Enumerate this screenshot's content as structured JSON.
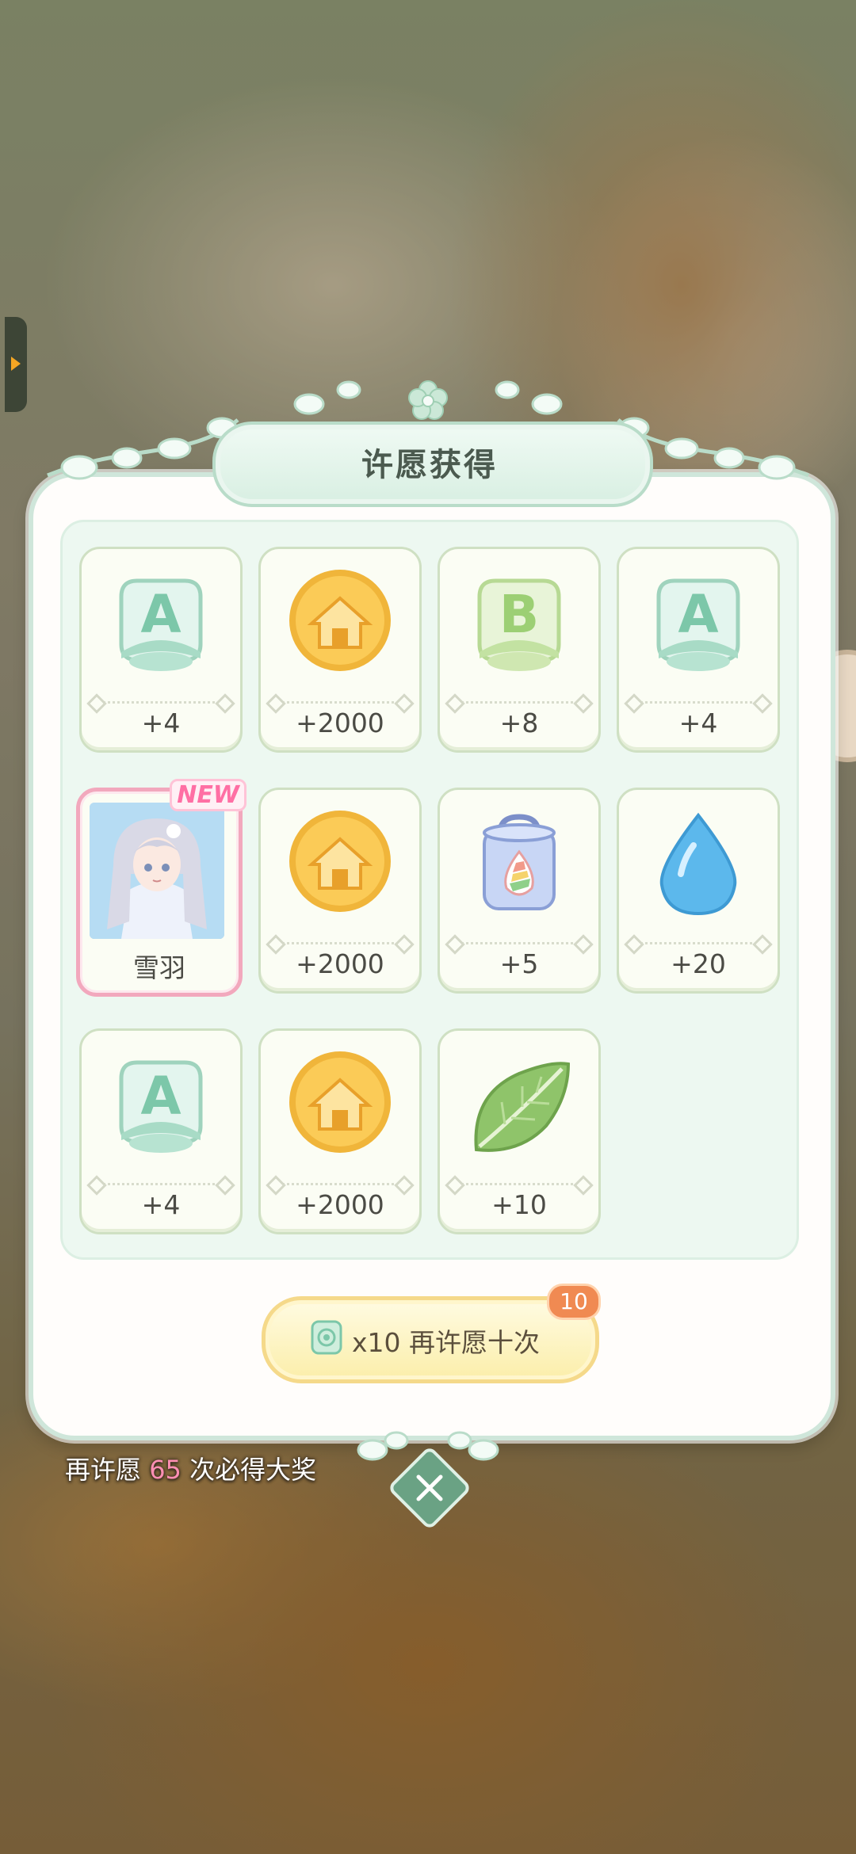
{
  "title": "许愿获得",
  "rewards": [
    {
      "kind": "ticket",
      "letter": "A",
      "icon": "ticket-a-icon",
      "qty": "+4"
    },
    {
      "kind": "coin",
      "icon": "house-coin-icon",
      "qty": "+2000"
    },
    {
      "kind": "ticket",
      "letter": "B",
      "icon": "ticket-b-icon",
      "qty": "+8"
    },
    {
      "kind": "ticket",
      "letter": "A",
      "icon": "ticket-a-icon",
      "qty": "+4"
    },
    {
      "kind": "character",
      "icon": "character-portrait",
      "qty": "雪羽",
      "badge": "NEW"
    },
    {
      "kind": "coin",
      "icon": "house-coin-icon",
      "qty": "+2000"
    },
    {
      "kind": "jar",
      "icon": "rainbow-drop-jar-icon",
      "qty": "+5"
    },
    {
      "kind": "drop",
      "icon": "water-drop-icon",
      "qty": "+20"
    },
    {
      "kind": "ticket",
      "letter": "A",
      "icon": "ticket-a-icon",
      "qty": "+4"
    },
    {
      "kind": "coin",
      "icon": "house-coin-icon",
      "qty": "+2000"
    },
    {
      "kind": "leaf",
      "icon": "leaf-icon",
      "qty": "+10"
    }
  ],
  "wish_button": {
    "label": "x10 再许愿十次",
    "badge": "10",
    "icon": "wish-ticket-icon"
  },
  "hint": {
    "prefix": "再许愿 ",
    "count": "65",
    "suffix": " 次必得大奖"
  },
  "colors": {
    "accent_green": "#6aa284",
    "badge_orange": "#f08a52",
    "pink": "#ff8fb3"
  }
}
